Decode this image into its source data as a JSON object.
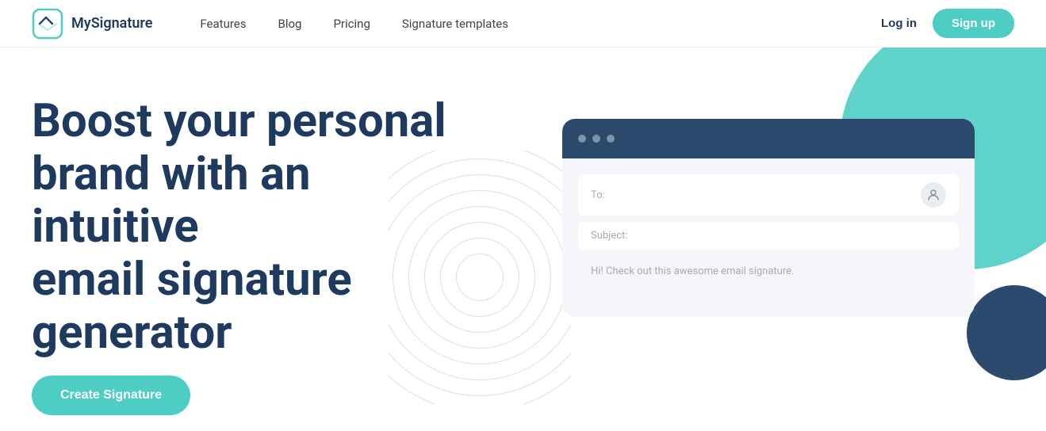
{
  "navbar": {
    "logo_text": "MySignature",
    "nav_items": [
      {
        "label": "Features",
        "id": "features"
      },
      {
        "label": "Blog",
        "id": "blog"
      },
      {
        "label": "Pricing",
        "id": "pricing"
      },
      {
        "label": "Signature templates",
        "id": "signature-templates"
      }
    ],
    "login_label": "Log in",
    "signup_label": "Sign up"
  },
  "hero": {
    "heading_line1": "Boost your personal",
    "heading_line2": "brand with an intuitive",
    "heading_line3": "email signature",
    "heading_line4": "generator",
    "cta_label": "Create Signature",
    "email_mock": {
      "to_label": "To:",
      "subject_label": "Subject:",
      "body_text": "Hi! Check out this awesome email signature."
    }
  },
  "colors": {
    "teal": "#4ecdc4",
    "navy": "#2c4a6e",
    "dark_navy": "#1e3a5f",
    "arc_color": "#b0c4d8"
  }
}
